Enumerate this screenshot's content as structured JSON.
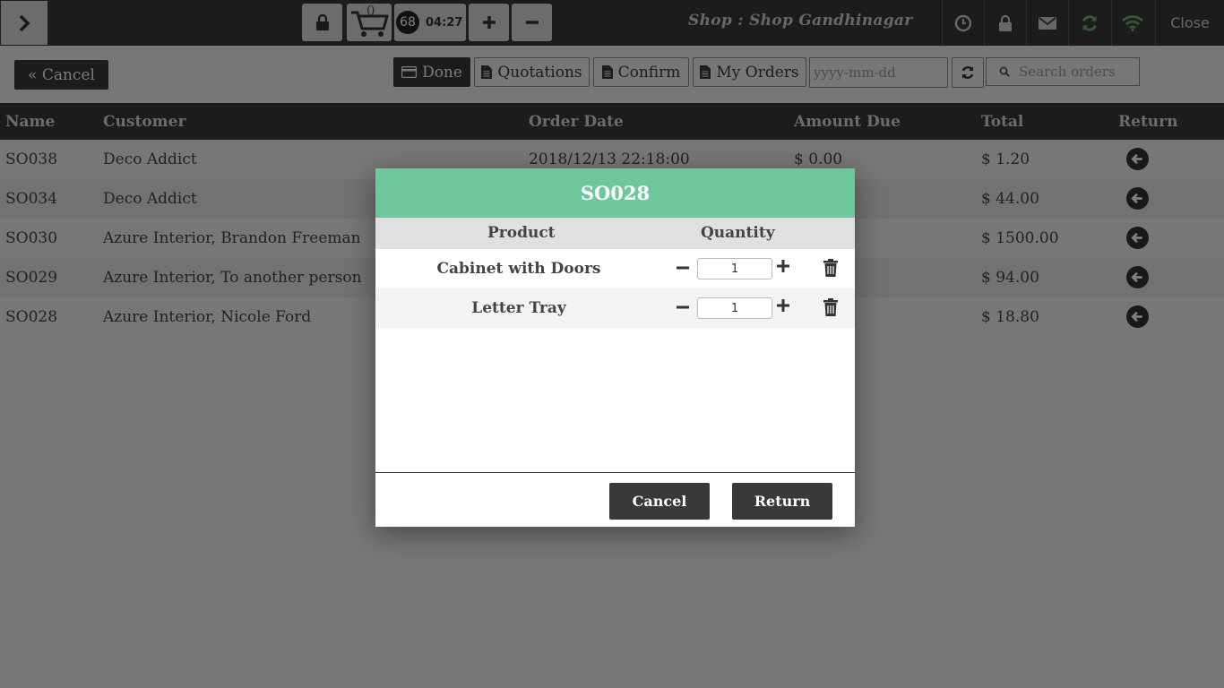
{
  "topbar": {
    "cart_count": "0",
    "order_sequence": "68",
    "order_time": "04:27",
    "shop_name": "Shop : Shop Gandhinagar",
    "close_label": "Close",
    "sync_color": "#5cb85c",
    "wifi_color": "#5cb85c"
  },
  "screen": {
    "cancel_label": "« Cancel",
    "filters": {
      "done": "Done",
      "quotations": "Quotations",
      "confirm": "Confirm",
      "my_orders": "My Orders"
    },
    "date_placeholder": "yyyy-mm-dd",
    "search_placeholder": "Search orders"
  },
  "table": {
    "headers": {
      "name": "Name",
      "customer": "Customer",
      "order_date": "Order Date",
      "amount_due": "Amount Due",
      "total": "Total",
      "return": "Return"
    },
    "rows": [
      {
        "name": "SO038",
        "customer": "Deco Addict",
        "order_date": "2018/12/13 22:18:00",
        "amount_due": "$ 0.00",
        "total": "$ 1.20"
      },
      {
        "name": "SO034",
        "customer": "Deco Addict",
        "order_date": "",
        "amount_due": "",
        "total": "$ 44.00"
      },
      {
        "name": "SO030",
        "customer": "Azure Interior, Brandon Freeman",
        "order_date": "",
        "amount_due": "",
        "total": "$ 1500.00"
      },
      {
        "name": "SO029",
        "customer": "Azure Interior, To another person",
        "order_date": "",
        "amount_due": "",
        "total": "$ 94.00"
      },
      {
        "name": "SO028",
        "customer": "Azure Interior, Nicole Ford",
        "order_date": "",
        "amount_due": "",
        "total": "$ 18.80"
      }
    ]
  },
  "modal": {
    "title": "SO028",
    "col_product": "Product",
    "col_quantity": "Quantity",
    "lines": [
      {
        "product": "Cabinet with Doors",
        "quantity": "1"
      },
      {
        "product": "Letter Tray",
        "quantity": "1"
      }
    ],
    "cancel_label": "Cancel",
    "return_label": "Return",
    "header_color": "#6ec89b"
  }
}
